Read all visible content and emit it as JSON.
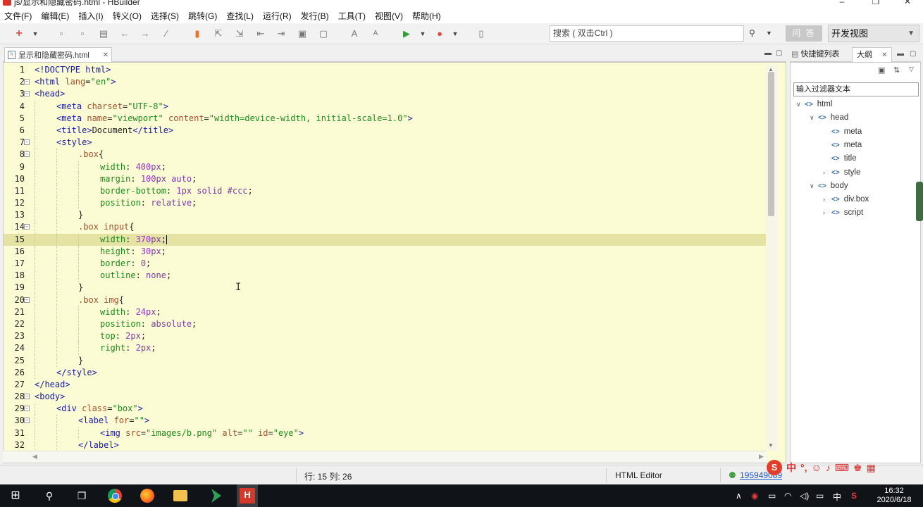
{
  "window": {
    "title": "js/显示和隐藏密码.html  -  HBuilder"
  },
  "menu": [
    "文件(F)",
    "编辑(E)",
    "插入(I)",
    "转义(O)",
    "选择(S)",
    "跳转(G)",
    "查找(L)",
    "运行(R)",
    "发行(B)",
    "工具(T)",
    "视图(V)",
    "帮助(H)"
  ],
  "toolbar": {
    "search_placeholder": "搜索 ( 双击Ctrl )",
    "ask_label": "问 答",
    "view_mode": "开发视图"
  },
  "editor": {
    "tab_label": "显示和隐藏密码.html",
    "lines": [
      {
        "n": "1",
        "fold": false,
        "indent": 0,
        "html": "<span class=\"t-tag\">&lt;!DOCTYPE html&gt;</span>"
      },
      {
        "n": "2",
        "fold": true,
        "indent": 0,
        "html": "<span class=\"t-tag\">&lt;html </span><span class=\"t-attr\">lang</span><span class=\"t-punc\">=</span><span class=\"t-str\">\"en\"</span><span class=\"t-tag\">&gt;</span>"
      },
      {
        "n": "3",
        "fold": true,
        "indent": 0,
        "html": "<span class=\"t-tag\">&lt;head&gt;</span>"
      },
      {
        "n": "4",
        "fold": false,
        "indent": 1,
        "html": "<span class=\"t-tag\">&lt;meta </span><span class=\"t-attr\">charset</span><span class=\"t-punc\">=</span><span class=\"t-str\">\"UTF-8\"</span><span class=\"t-tag\">&gt;</span>"
      },
      {
        "n": "5",
        "fold": false,
        "indent": 1,
        "html": "<span class=\"t-tag\">&lt;meta </span><span class=\"t-attr\">name</span><span class=\"t-punc\">=</span><span class=\"t-str\">\"viewport\"</span><span class=\"t-attr\"> content</span><span class=\"t-punc\">=</span><span class=\"t-str\">\"width=device-width, initial-scale=1.0\"</span><span class=\"t-tag\">&gt;</span>"
      },
      {
        "n": "6",
        "fold": false,
        "indent": 1,
        "html": "<span class=\"t-tag\">&lt;title&gt;</span><span class=\"t-punc\">Document</span><span class=\"t-tag\">&lt;/title&gt;</span>"
      },
      {
        "n": "7",
        "fold": true,
        "indent": 1,
        "html": "<span class=\"t-tag\">&lt;style&gt;</span>"
      },
      {
        "n": "8",
        "fold": true,
        "indent": 2,
        "html": "<span class=\"t-sel\">.box</span><span class=\"t-punc\">{</span>"
      },
      {
        "n": "9",
        "fold": false,
        "indent": 3,
        "html": "<span class=\"t-prop\">width</span><span class=\"t-punc\">: </span><span class=\"t-num\">400</span><span class=\"t-val\">px</span><span class=\"t-punc\">;</span>"
      },
      {
        "n": "10",
        "fold": false,
        "indent": 3,
        "html": "<span class=\"t-prop\">margin</span><span class=\"t-punc\">: </span><span class=\"t-num\">100</span><span class=\"t-val\">px auto</span><span class=\"t-punc\">;</span>"
      },
      {
        "n": "11",
        "fold": false,
        "indent": 3,
        "html": "<span class=\"t-prop\">border-bottom</span><span class=\"t-punc\">: </span><span class=\"t-num\">1</span><span class=\"t-val\">px solid #ccc</span><span class=\"t-punc\">;</span>"
      },
      {
        "n": "12",
        "fold": false,
        "indent": 3,
        "html": "<span class=\"t-prop\">position</span><span class=\"t-punc\">: </span><span class=\"t-val\">relative</span><span class=\"t-punc\">;</span>"
      },
      {
        "n": "13",
        "fold": false,
        "indent": 2,
        "html": "<span class=\"t-punc\">}</span>"
      },
      {
        "n": "14",
        "fold": true,
        "indent": 2,
        "html": "<span class=\"t-sel\">.box input</span><span class=\"t-punc\">{</span>"
      },
      {
        "n": "15",
        "fold": false,
        "indent": 3,
        "current": true,
        "html": "<span class=\"t-prop\">width</span><span class=\"t-punc\">: </span><span class=\"t-num\">370</span><span class=\"t-val\">px</span><span class=\"t-punc\">;</span><span class=\"caret-mark\"></span>"
      },
      {
        "n": "16",
        "fold": false,
        "indent": 3,
        "html": "<span class=\"t-prop\">height</span><span class=\"t-punc\">: </span><span class=\"t-num\">30</span><span class=\"t-val\">px</span><span class=\"t-punc\">;</span>"
      },
      {
        "n": "17",
        "fold": false,
        "indent": 3,
        "html": "<span class=\"t-prop\">border</span><span class=\"t-punc\">: </span><span class=\"t-num\">0</span><span class=\"t-punc\">;</span>"
      },
      {
        "n": "18",
        "fold": false,
        "indent": 3,
        "html": "<span class=\"t-prop\">outline</span><span class=\"t-punc\">: </span><span class=\"t-val\">none</span><span class=\"t-punc\">;</span>"
      },
      {
        "n": "19",
        "fold": false,
        "indent": 2,
        "html": "<span class=\"t-punc\">}</span>"
      },
      {
        "n": "20",
        "fold": true,
        "indent": 2,
        "html": "<span class=\"t-sel\">.box img</span><span class=\"t-punc\">{</span>"
      },
      {
        "n": "21",
        "fold": false,
        "indent": 3,
        "html": "<span class=\"t-prop\">width</span><span class=\"t-punc\">: </span><span class=\"t-num\">24</span><span class=\"t-val\">px</span><span class=\"t-punc\">;</span>"
      },
      {
        "n": "22",
        "fold": false,
        "indent": 3,
        "html": "<span class=\"t-prop\">position</span><span class=\"t-punc\">: </span><span class=\"t-val\">absolute</span><span class=\"t-punc\">;</span>"
      },
      {
        "n": "23",
        "fold": false,
        "indent": 3,
        "html": "<span class=\"t-prop\">top</span><span class=\"t-punc\">: </span><span class=\"t-num\">2</span><span class=\"t-val\">px</span><span class=\"t-punc\">;</span>"
      },
      {
        "n": "24",
        "fold": false,
        "indent": 3,
        "html": "<span class=\"t-prop\">right</span><span class=\"t-punc\">: </span><span class=\"t-num\">2</span><span class=\"t-val\">px</span><span class=\"t-punc\">;</span>"
      },
      {
        "n": "25",
        "fold": false,
        "indent": 2,
        "html": "<span class=\"t-punc\">}</span>"
      },
      {
        "n": "26",
        "fold": false,
        "indent": 1,
        "html": "<span class=\"t-tag\">&lt;/style&gt;</span>"
      },
      {
        "n": "27",
        "fold": false,
        "indent": 0,
        "html": "<span class=\"t-tag\">&lt;/head&gt;</span>"
      },
      {
        "n": "28",
        "fold": true,
        "indent": 0,
        "html": "<span class=\"t-tag\">&lt;body&gt;</span>"
      },
      {
        "n": "29",
        "fold": true,
        "indent": 1,
        "html": "<span class=\"t-tag\">&lt;div </span><span class=\"t-attr\">class</span><span class=\"t-punc\">=</span><span class=\"t-str\">\"box\"</span><span class=\"t-tag\">&gt;</span>"
      },
      {
        "n": "30",
        "fold": true,
        "indent": 2,
        "html": "<span class=\"t-tag\">&lt;label </span><span class=\"t-attr\">for</span><span class=\"t-punc\">=</span><span class=\"t-str\">\"\"</span><span class=\"t-tag\">&gt;</span>"
      },
      {
        "n": "31",
        "fold": false,
        "indent": 3,
        "html": "<span class=\"t-tag\">&lt;img </span><span class=\"t-attr\">src</span><span class=\"t-punc\">=</span><span class=\"t-str\">\"images/b.png\"</span><span class=\"t-attr\"> alt</span><span class=\"t-punc\">=</span><span class=\"t-str\">\"\"</span><span class=\"t-attr\"> id</span><span class=\"t-punc\">=</span><span class=\"t-str\">\"eye\"</span><span class=\"t-tag\">&gt;</span>"
      },
      {
        "n": "32",
        "fold": false,
        "indent": 2,
        "html": "<span class=\"t-tag\">&lt;/label&gt;</span>"
      }
    ]
  },
  "right_panel": {
    "tab_shortcuts": "快捷键列表",
    "tab_outline": "大纲",
    "filter_placeholder": "输入过滤器文本",
    "tree": [
      {
        "label": "html",
        "level": 0,
        "toggle": "expanded"
      },
      {
        "label": "head",
        "level": 1,
        "toggle": "expanded"
      },
      {
        "label": "meta",
        "level": 2,
        "toggle": "none"
      },
      {
        "label": "meta",
        "level": 2,
        "toggle": "none"
      },
      {
        "label": "title",
        "level": 2,
        "toggle": "none"
      },
      {
        "label": "style",
        "level": 2,
        "toggle": "collapsed"
      },
      {
        "label": "body",
        "level": 1,
        "toggle": "expanded"
      },
      {
        "label": "div.box",
        "level": 2,
        "toggle": "collapsed"
      },
      {
        "label": "script",
        "level": 2,
        "toggle": "collapsed"
      }
    ]
  },
  "status": {
    "position": "行: 15 列: 26",
    "editor_type": "HTML Editor",
    "account": "195949089"
  },
  "taskbar": {
    "time": "16:32",
    "date": "2020/6/18",
    "ime": "中"
  }
}
